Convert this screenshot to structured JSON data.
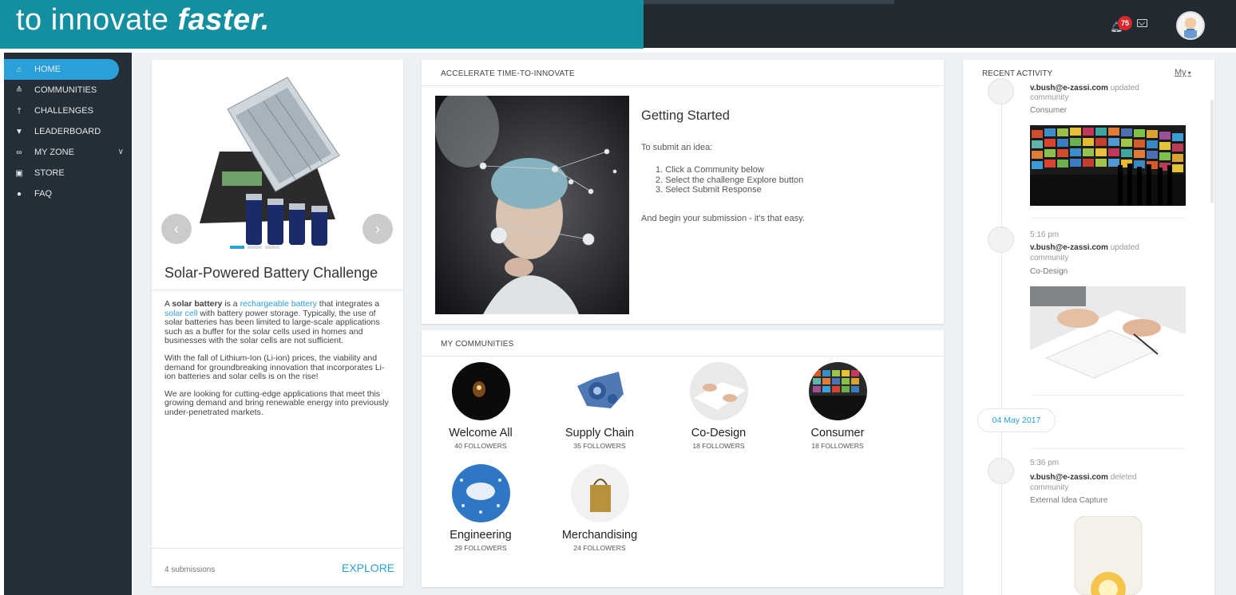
{
  "banner": {
    "text_normal": "to innovate ",
    "text_bold": "faster."
  },
  "header": {
    "notification_count": "75",
    "icons": [
      "bell-icon",
      "mail-icon",
      "avatar"
    ]
  },
  "sidebar": {
    "items": [
      {
        "label": "HOME",
        "icon": "home-icon",
        "active": true
      },
      {
        "label": "COMMUNITIES",
        "icon": "communities-icon"
      },
      {
        "label": "CHALLENGES",
        "icon": "challenges-icon"
      },
      {
        "label": "LEADERBOARD",
        "icon": "trophy-icon"
      },
      {
        "label": "MY ZONE",
        "icon": "zone-icon",
        "caret": "chevron-down-icon"
      },
      {
        "label": "STORE",
        "icon": "store-icon"
      },
      {
        "label": "FAQ",
        "icon": "question-icon"
      }
    ]
  },
  "challenge": {
    "title": "Solar-Powered Battery Challenge",
    "p1_a": "A ",
    "p1_b": "solar battery",
    "p1_c": " is a ",
    "p1_link1": "rechargeable battery",
    "p1_d": " that integrates a ",
    "p1_link2": "solar cell",
    "p1_e": " with battery power storage. Typically, the use of solar batteries has been limited to large-scale applications such as a buffer for the solar cells used in homes and businesses with the solar cells are not sufficient.",
    "p2": "With the fall of Lithium-Ion (Li-ion) prices, the viability and demand for groundbreaking innovation that incorporates Li-ion batteries and solar cells is on the rise!",
    "p3": "We are looking for cutting-edge applications that meet this growing demand and bring renewable energy into previously under-penetrated markets.",
    "submissions": "4 submissions",
    "explore": "EXPLORE"
  },
  "accelerate": {
    "header": "ACCELERATE TIME-TO-INNOVATE",
    "title": "Getting Started",
    "intro": "To submit an idea:",
    "steps": [
      "1. Click a Community below",
      "2. Select the challenge Explore button",
      "3. Select Submit Response"
    ],
    "tail": "And begin your submission - it's that easy."
  },
  "communities": {
    "header": "MY COMMUNITIES",
    "items": [
      {
        "name": "Welcome All",
        "followers": "40 FOLLOWERS"
      },
      {
        "name": "Supply Chain",
        "followers": "35 FOLLOWERS"
      },
      {
        "name": "Co-Design",
        "followers": "18 FOLLOWERS"
      },
      {
        "name": "Consumer",
        "followers": "18 FOLLOWERS"
      },
      {
        "name": "Engineering",
        "followers": "29 FOLLOWERS"
      },
      {
        "name": "Merchandising",
        "followers": "24 FOLLOWERS"
      }
    ]
  },
  "activity": {
    "header": "RECENT ACTIVITY",
    "filter": "My",
    "entries": [
      {
        "time": "",
        "user": "v.bush@e-zassi.com",
        "action": " updated",
        "sub": "community",
        "name": "Consumer"
      },
      {
        "time": "5:16 pm",
        "user": "v.bush@e-zassi.com",
        "action": " updated",
        "sub": "community",
        "name": "Co-Design"
      },
      {
        "time": "5:36 pm",
        "user": "v.bush@e-zassi.com",
        "action": " deleted",
        "sub": "community",
        "name": "External Idea Capture"
      }
    ],
    "date": "04 May 2017"
  }
}
